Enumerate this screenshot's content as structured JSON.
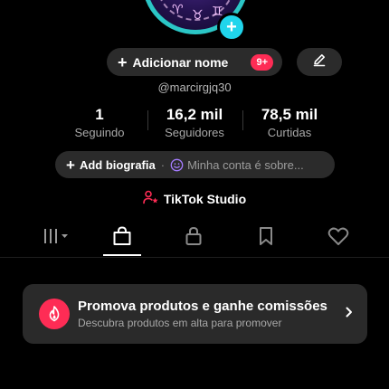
{
  "profile": {
    "add_name_label": "Adicionar nome",
    "add_name_plus": "+",
    "notification_badge": "9+",
    "username": "@marcirgjq30",
    "avatar_plus": "+"
  },
  "stats": [
    {
      "value": "1",
      "label": "Seguindo"
    },
    {
      "value": "16,2 mil",
      "label": "Seguidores"
    },
    {
      "value": "78,5 mil",
      "label": "Curtidas"
    }
  ],
  "bio": {
    "plus": "+",
    "add_label": "Add biografia",
    "separator": "·",
    "status_text": "Minha conta é sobre..."
  },
  "studio": {
    "label": "TikTok Studio"
  },
  "tabs": [
    {
      "icon": "grid-icon",
      "active": false
    },
    {
      "icon": "shopping-bag-icon",
      "active": true
    },
    {
      "icon": "lock-icon",
      "active": false
    },
    {
      "icon": "bookmark-icon",
      "active": false
    },
    {
      "icon": "heart-icon",
      "active": false
    }
  ],
  "promo": {
    "title": "Promova produtos e ganhe comissões",
    "subtitle": "Descubra produtos em alta para promover"
  },
  "colors": {
    "accent_red": "#fe2c55",
    "accent_cyan": "#20d5ec",
    "background": "#000000"
  }
}
